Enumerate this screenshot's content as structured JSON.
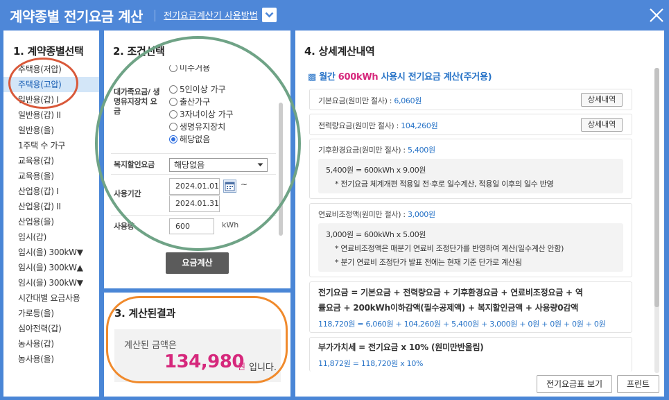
{
  "window": {
    "title": "계약종별 전기요금 계산",
    "help_link": "전기요금계산기 사용방법"
  },
  "panel1": {
    "heading": "1. 계약종별선택",
    "items": [
      "주택용(저압)",
      "주택용(고압)",
      "일반용(갑) I",
      "일반용(갑) II",
      "일반용(을)",
      "1주택 수 가구",
      "교육용(갑)",
      "교육용(을)",
      "산업용(갑) I",
      "산업용(갑) II",
      "산업용(을)",
      "임시(갑)",
      "임시(을) 300kW▼",
      "임시(을) 300kW▲",
      "임시(을) 300kW▼",
      "시간대별 요금사용",
      "가로등(을)",
      "심야전력(갑)",
      "농사용(갑)",
      "농사용(을)"
    ],
    "selected_index": 1
  },
  "panel2": {
    "heading": "2. 조건선택",
    "partial_option": "미수거용",
    "discount_label": "대가족요금/ 생명유지장치 요금",
    "discount_options": [
      "5인이상 가구",
      "출산가구",
      "3자녀이상 가구",
      "생명유지장치",
      "해당없음"
    ],
    "discount_selected": 4,
    "welfare_label": "복지할인요금",
    "welfare_value": "해당없음",
    "period_label": "사용기간",
    "start_date": "2024.01.01",
    "end_date": "2024.01.31",
    "tilde": "~",
    "usage_label": "사용량",
    "usage_value": "600",
    "usage_unit": "kWh",
    "calc_button": "요금계산"
  },
  "panel3": {
    "heading": "3. 계산된결과",
    "label": "계산된 금액은",
    "amount": "134,980",
    "unit": "원",
    "suffix": "입니다."
  },
  "panel4": {
    "heading": "4. 상세계산내역",
    "marker": "▩",
    "header_pre": "월간",
    "header_usage": "600kWh",
    "header_post": "사용시 전기요금 계산(주거용)",
    "base_label": "기본요금(원미만 절사) :",
    "base_value": "6,060원",
    "energy_label": "전력량요금(원미만 절사) :",
    "energy_value": "104,260원",
    "detail_button": "상세내역",
    "climate_label": "기후환경요금(원미만 절사) :",
    "climate_value": "5,400원",
    "climate_formula": "5,400원 = 600kWh x 9.00원",
    "climate_note": "* 전기요금 체계개편 적용일 전·후로 일수계산, 적용일 이후의 일수 반영",
    "fuel_label": "연료비조정액(원미만 절사) :",
    "fuel_value": "3,000원",
    "fuel_formula": "3,000원 = 600kWh x 5.00원",
    "fuel_note1": "* 연료비조정액은 매분기 연료비 조정단가를 반영하여 계산(일수계산 안함)",
    "fuel_note2": "* 분기 연료비 조정단가 발표 전에는 현재 기준 단가로 계산됨",
    "sum_line1": "전기요금 = 기본요금 + 전력량요금 + 기후환경요금 + 연료비조정요금 + 역",
    "sum_line2": "률요금 + 200kWh이하감액(필수공제액) + 복지할인금액 + 사용량0감액",
    "sum_values": "118,720원 = 6,060원 + 104,260원 + 5,400원 + 3,000원 + 0원 + 0원 + 0원 + 0원",
    "vat_line": "부가가치세 = 전기요금 x 10% (원미만반올림)",
    "vat_values": "11,872원 = 118,720원 x 10%",
    "rate_table_button": "전기요금표 보기",
    "print_button": "프린트"
  },
  "colors": {
    "titlebar": "#4e87d8",
    "accent_blue": "#2773c7",
    "amount_pink": "#d6287c",
    "annotation_red": "#d9593a",
    "annotation_green": "#6fa386",
    "annotation_orange": "#f08a2c"
  },
  "icons": [
    "chevron-down-icon",
    "close-icon",
    "calendar-icon"
  ]
}
